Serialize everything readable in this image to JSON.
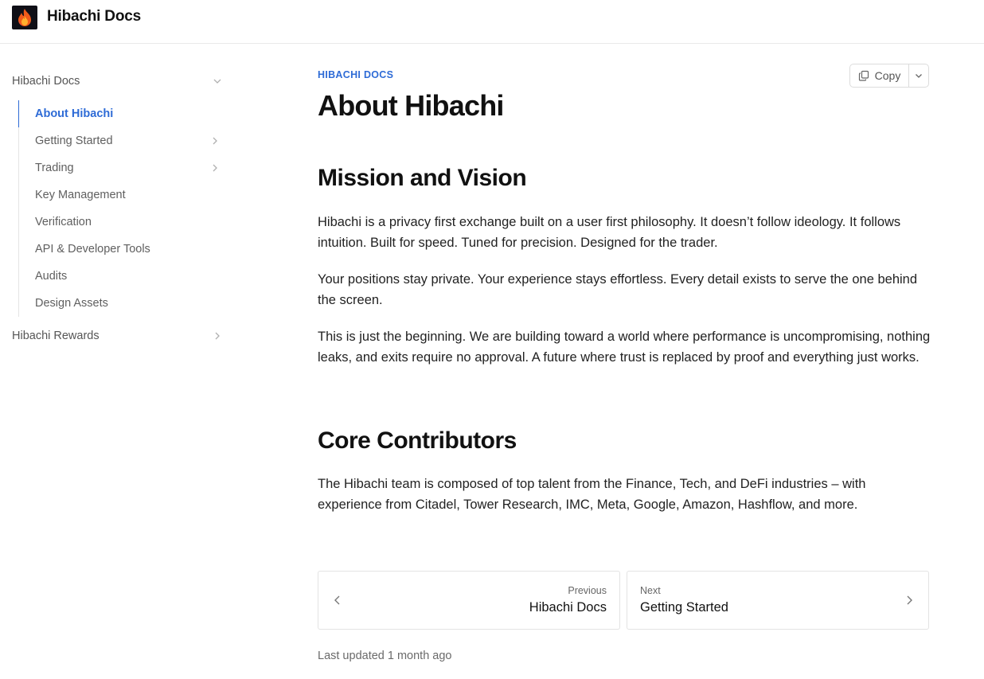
{
  "header": {
    "brand": "Hibachi Docs",
    "logo_icon": "flame-icon"
  },
  "sidebar": {
    "root": {
      "label": "Hibachi Docs",
      "expanded": true
    },
    "items": [
      {
        "label": "About Hibachi",
        "active": true,
        "has_children": false
      },
      {
        "label": "Getting Started",
        "active": false,
        "has_children": true
      },
      {
        "label": "Trading",
        "active": false,
        "has_children": true
      },
      {
        "label": "Key Management",
        "active": false,
        "has_children": false
      },
      {
        "label": "Verification",
        "active": false,
        "has_children": false
      },
      {
        "label": "API & Developer Tools",
        "active": false,
        "has_children": false
      },
      {
        "label": "Audits",
        "active": false,
        "has_children": false
      },
      {
        "label": "Design Assets",
        "active": false,
        "has_children": false
      }
    ],
    "rewards": {
      "label": "Hibachi Rewards",
      "has_children": true
    }
  },
  "main": {
    "eyebrow": "HIBACHI DOCS",
    "title": "About Hibachi",
    "copy_button": {
      "label": "Copy"
    },
    "sections": [
      {
        "heading": "Mission and Vision",
        "paragraphs": [
          "Hibachi is a privacy first exchange built on a user first philosophy. It doesn’t follow ideology. It follows intuition. Built for speed. Tuned for precision. Designed for the trader.",
          "Your positions stay private. Your experience stays effortless. Every detail exists to serve the one behind the screen.",
          "This is just the beginning. We are building toward a world where performance is uncompromising, nothing leaks, and exits require no approval. A future where trust is replaced by proof and everything just works."
        ]
      },
      {
        "heading": "Core Contributors",
        "paragraphs": [
          "The Hibachi team is composed of top talent from the Finance, Tech, and DeFi industries – with experience from Citadel, Tower Research, IMC, Meta, Google, Amazon, Hashflow, and more."
        ]
      }
    ],
    "pager": {
      "prev": {
        "caption": "Previous",
        "title": "Hibachi Docs"
      },
      "next": {
        "caption": "Next",
        "title": "Getting Started"
      }
    },
    "last_updated": "Last updated 1 month ago"
  },
  "colors": {
    "accent": "#2e6bd6",
    "logo_bg": "#0f0f17",
    "flame_outer": "#f05a1a",
    "flame_inner": "#ffb02e"
  }
}
